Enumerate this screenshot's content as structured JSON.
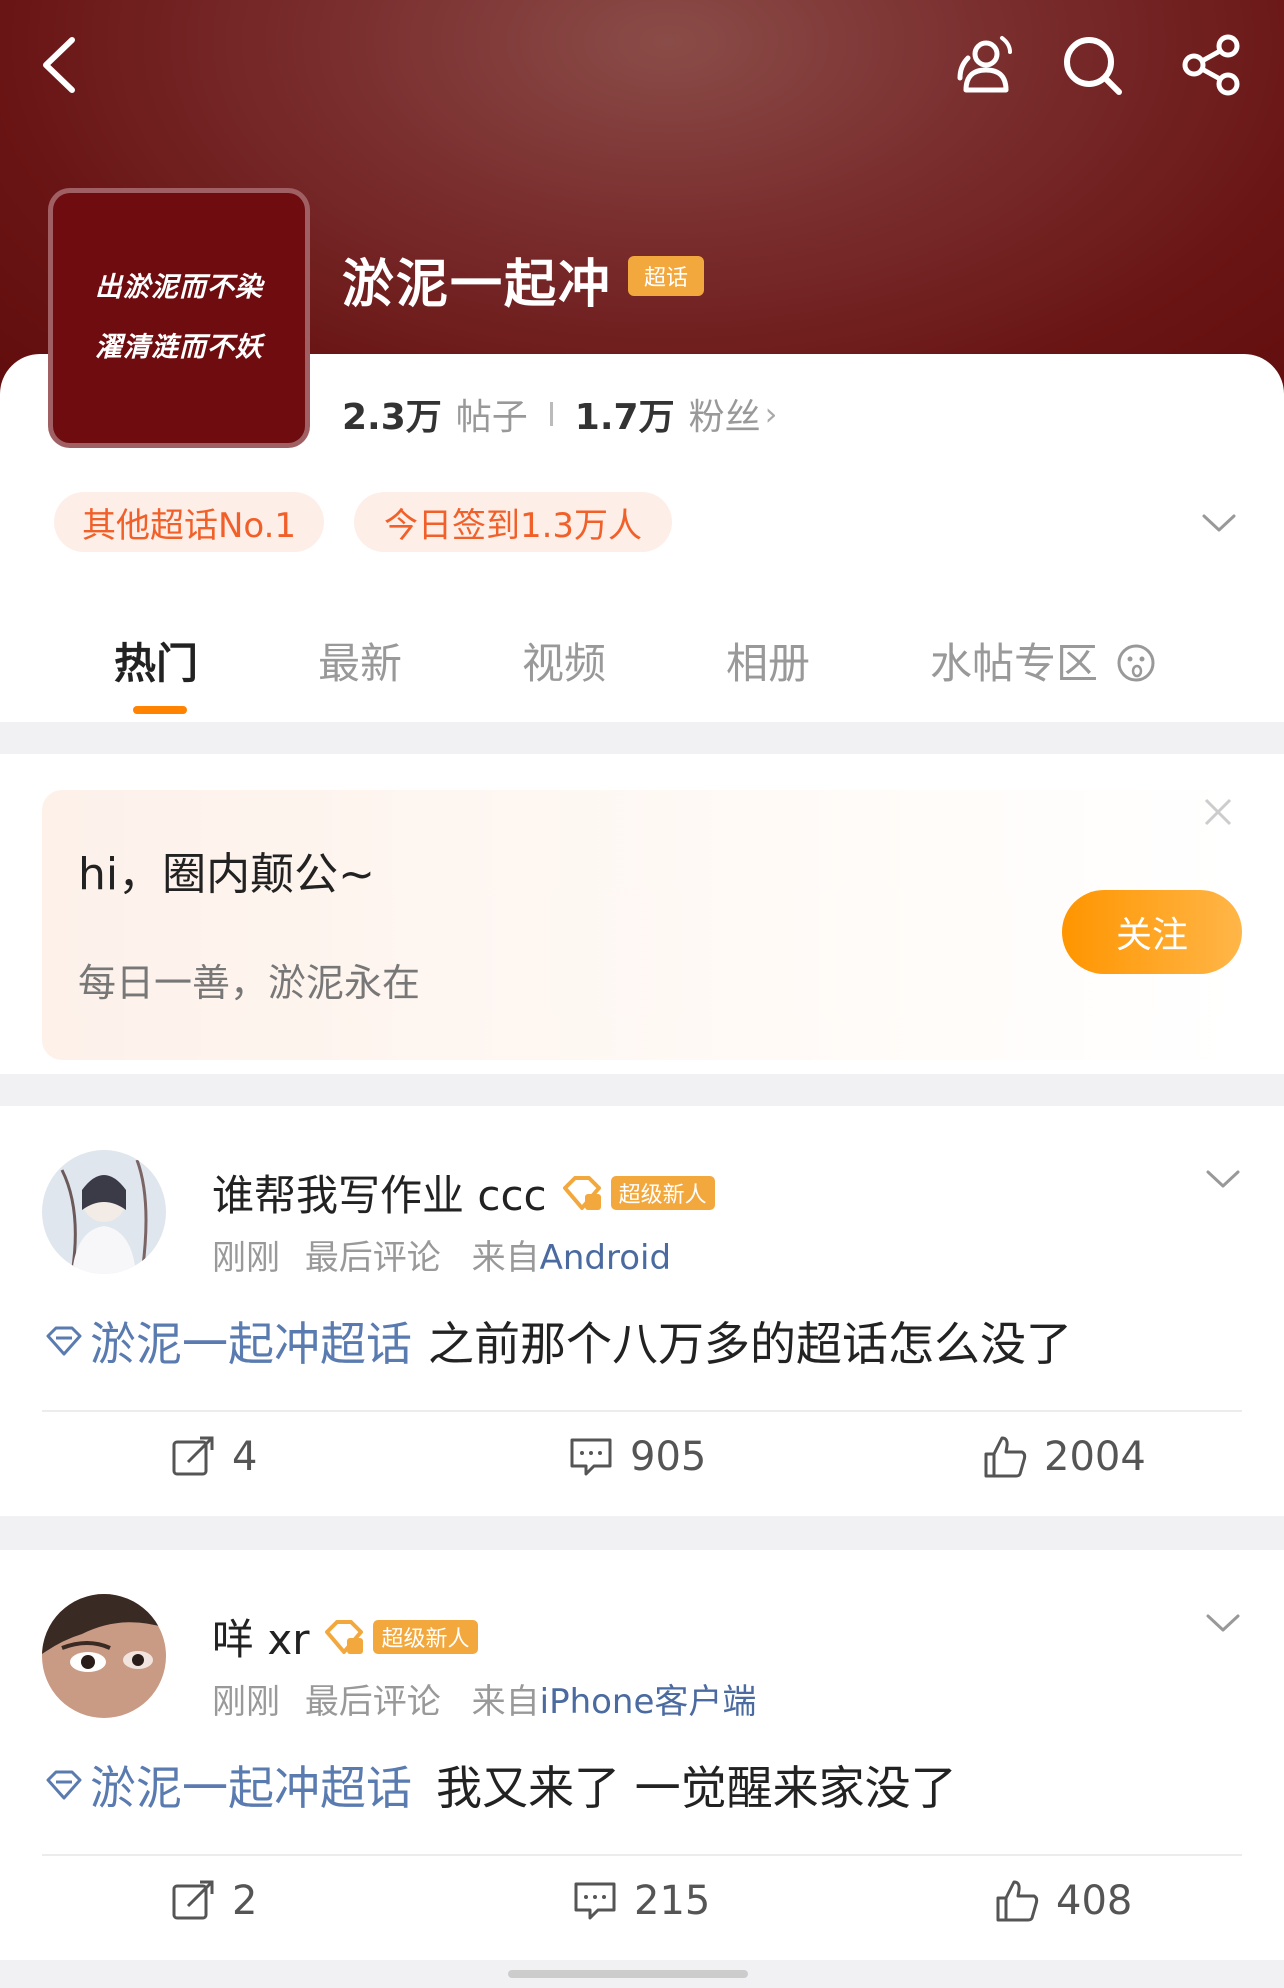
{
  "header": {
    "icons": [
      "back-icon",
      "people-icon",
      "search-icon",
      "share-icon"
    ],
    "avatar_lines": [
      "出淤泥而不染",
      "濯清涟而不妖"
    ],
    "title": "淤泥一起冲",
    "badge": "超话"
  },
  "stats": {
    "posts_num": "2.3万",
    "posts_label": "帖子",
    "fans_num": "1.7万",
    "fans_label": "粉丝"
  },
  "pills": [
    "其他超话No.1",
    "今日签到1.3万人"
  ],
  "tabs": [
    "热门",
    "最新",
    "视频",
    "相册",
    "水帖专区"
  ],
  "welcome": {
    "title": "hi，圈内颠公~",
    "subtitle": "每日一善，淤泥永在",
    "follow_label": "关注"
  },
  "posts": [
    {
      "username": "谁帮我写作业 ccc",
      "badge": "超级新人",
      "time": "刚刚",
      "activity": "最后评论",
      "source_prefix": "来自",
      "source": "Android",
      "topic": "淤泥一起冲超话",
      "text": "之前那个八万多的超话怎么没了",
      "reposts": "4",
      "comments": "905",
      "likes": "2004"
    },
    {
      "username": "咩 xr",
      "badge": "超级新人",
      "time": "刚刚",
      "activity": "最后评论",
      "source_prefix": "来自",
      "source": "iPhone客户端",
      "topic": "淤泥一起冲超话",
      "text": "我又来了 一觉醒来家没了",
      "reposts": "2",
      "comments": "215",
      "likes": "408"
    }
  ],
  "colors": {
    "header_bg": "#6a1515",
    "accent_orange": "#ff8200",
    "pill_text": "#f2602a",
    "badge_gold": "#f3a83e",
    "link_blue": "#5a7bb0"
  }
}
